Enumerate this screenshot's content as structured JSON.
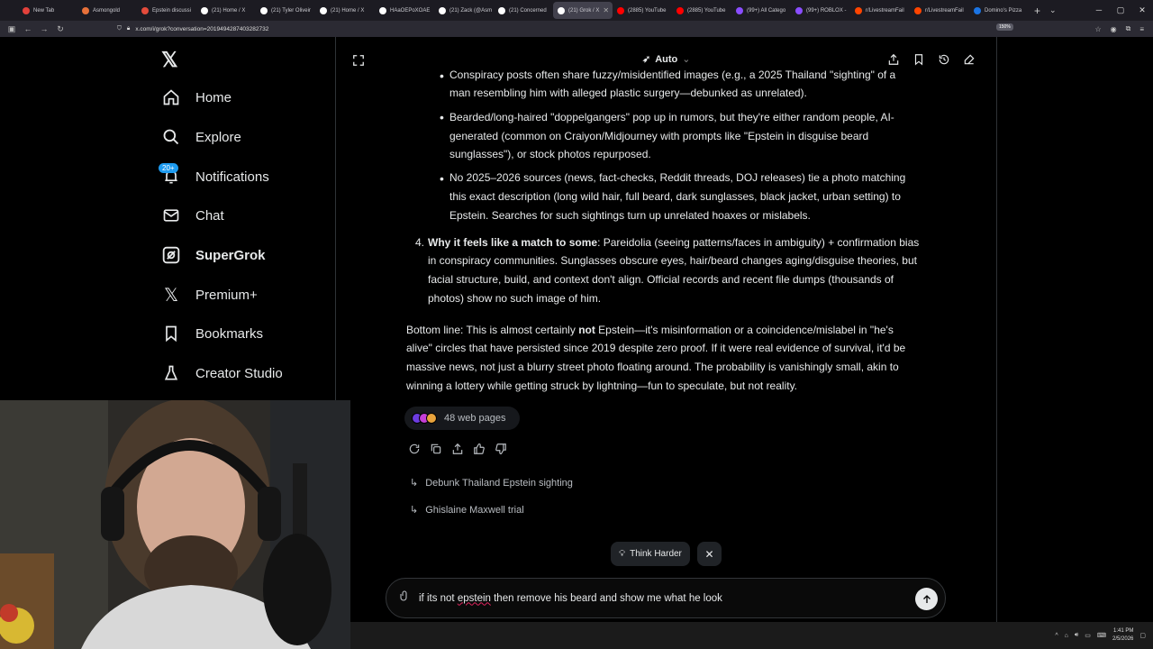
{
  "browser": {
    "tabs": [
      {
        "label": "New Tab",
        "color": "#e2413b"
      },
      {
        "label": "Asmongold",
        "color": "#e8713a"
      },
      {
        "label": "Epstein discussi",
        "color": "#e34b3b"
      },
      {
        "label": "(21) Home / X",
        "color": "#ffffff"
      },
      {
        "label": "(21) Tyler Oliveir",
        "color": "#ffffff"
      },
      {
        "label": "(21) Home / X",
        "color": "#ffffff"
      },
      {
        "label": "HAaOEPoXOAE",
        "color": "#ffffff"
      },
      {
        "label": "(21) Zack (@Asm",
        "color": "#ffffff"
      },
      {
        "label": "(21) Concerned",
        "color": "#ffffff"
      },
      {
        "label": "(21) Grok / X",
        "color": "#ffffff",
        "active": true
      },
      {
        "label": "(2885) YouTube",
        "color": "#ff0000"
      },
      {
        "label": "(2885) YouTube",
        "color": "#ff0000"
      },
      {
        "label": "(99+) All Catego",
        "color": "#8a4dff"
      },
      {
        "label": "(99+) ROBLOX -",
        "color": "#8a4dff"
      },
      {
        "label": "r/LivestreamFail",
        "color": "#ff4500"
      },
      {
        "label": "r/LivestreamFail",
        "color": "#ff4500"
      },
      {
        "label": "Domino's Pizza",
        "color": "#1b74e4"
      }
    ],
    "url": "x.com/i/grok?conversation=2019494287403282732",
    "zoom": "150%"
  },
  "sidebar": {
    "items": [
      {
        "label": "Home",
        "icon": "home-icon"
      },
      {
        "label": "Explore",
        "icon": "search-icon"
      },
      {
        "label": "Notifications",
        "icon": "bell-icon",
        "badge": "20+"
      },
      {
        "label": "Chat",
        "icon": "mail-icon"
      },
      {
        "label": "SuperGrok",
        "icon": "grok-icon"
      },
      {
        "label": "Premium+",
        "icon": "x-icon"
      },
      {
        "label": "Bookmarks",
        "icon": "bookmark-icon"
      },
      {
        "label": "Creator Studio",
        "icon": "flask-icon"
      }
    ]
  },
  "header": {
    "model": "Auto"
  },
  "content": {
    "bullet1_l1": "Conspiracy posts often share fuzzy/misidentified images (e.g., a 2025 Thailand \"sighting\" of a",
    "bullet1_l2": "man resembling him with alleged plastic surgery—debunked as unrelated).",
    "bullet2_l1": "Bearded/long-haired \"doppelgangers\" pop up in rumors, but they're either random people, AI-",
    "bullet2_l2": "generated (common on Craiyon/Midjourney with prompts like \"Epstein in disguise beard",
    "bullet2_l3": "sunglasses\"), or stock photos repurposed.",
    "bullet3_l1": "No 2025–2026 sources (news, fact-checks, Reddit threads, DOJ releases) tie a photo matching",
    "bullet3_l2": "this exact description (long wild hair, full beard, dark sunglasses, black jacket, urban setting) to",
    "bullet3_l3": "Epstein. Searches for such sightings turn up unrelated hoaxes or mislabels.",
    "item4_num": "4.",
    "item4_bold": "Why it feels like a match to some",
    "item4_l1": ": Pareidolia (seeing patterns/faces in ambiguity) + confirmation bias",
    "item4_l2": "in conspiracy communities. Sunglasses obscure eyes, hair/beard changes aging/disguise theories, but",
    "item4_l3": "facial structure, build, and context don't align. Official records and recent file dumps (thousands of",
    "item4_l4": "photos) show no such image of him.",
    "bottom_pre": "Bottom line: This is almost certainly ",
    "bottom_bold": "not",
    "bottom_l1": " Epstein—it's misinformation or a coincidence/mislabel in \"he's",
    "bottom_l2": "alive\" circles that have persisted since 2019 despite zero proof. If it were real evidence of survival, it'd be",
    "bottom_l3": "massive news, not just a blurry street photo floating around. The probability is vanishingly small, akin to",
    "bottom_l4": "winning a lottery while getting struck by lightning—fun to speculate, but not reality."
  },
  "sources": {
    "label": "48 web pages"
  },
  "suggestions": [
    "Debunk Thailand Epstein sighting",
    "Ghislaine Maxwell trial"
  ],
  "think_harder": "Think Harder",
  "composer": {
    "pre": "if its not ",
    "misspelled": "epstein",
    "post": " then remove his beard and show me what he look"
  },
  "taskbar": {
    "time": "1:41 PM",
    "date": "2/5/2026"
  }
}
